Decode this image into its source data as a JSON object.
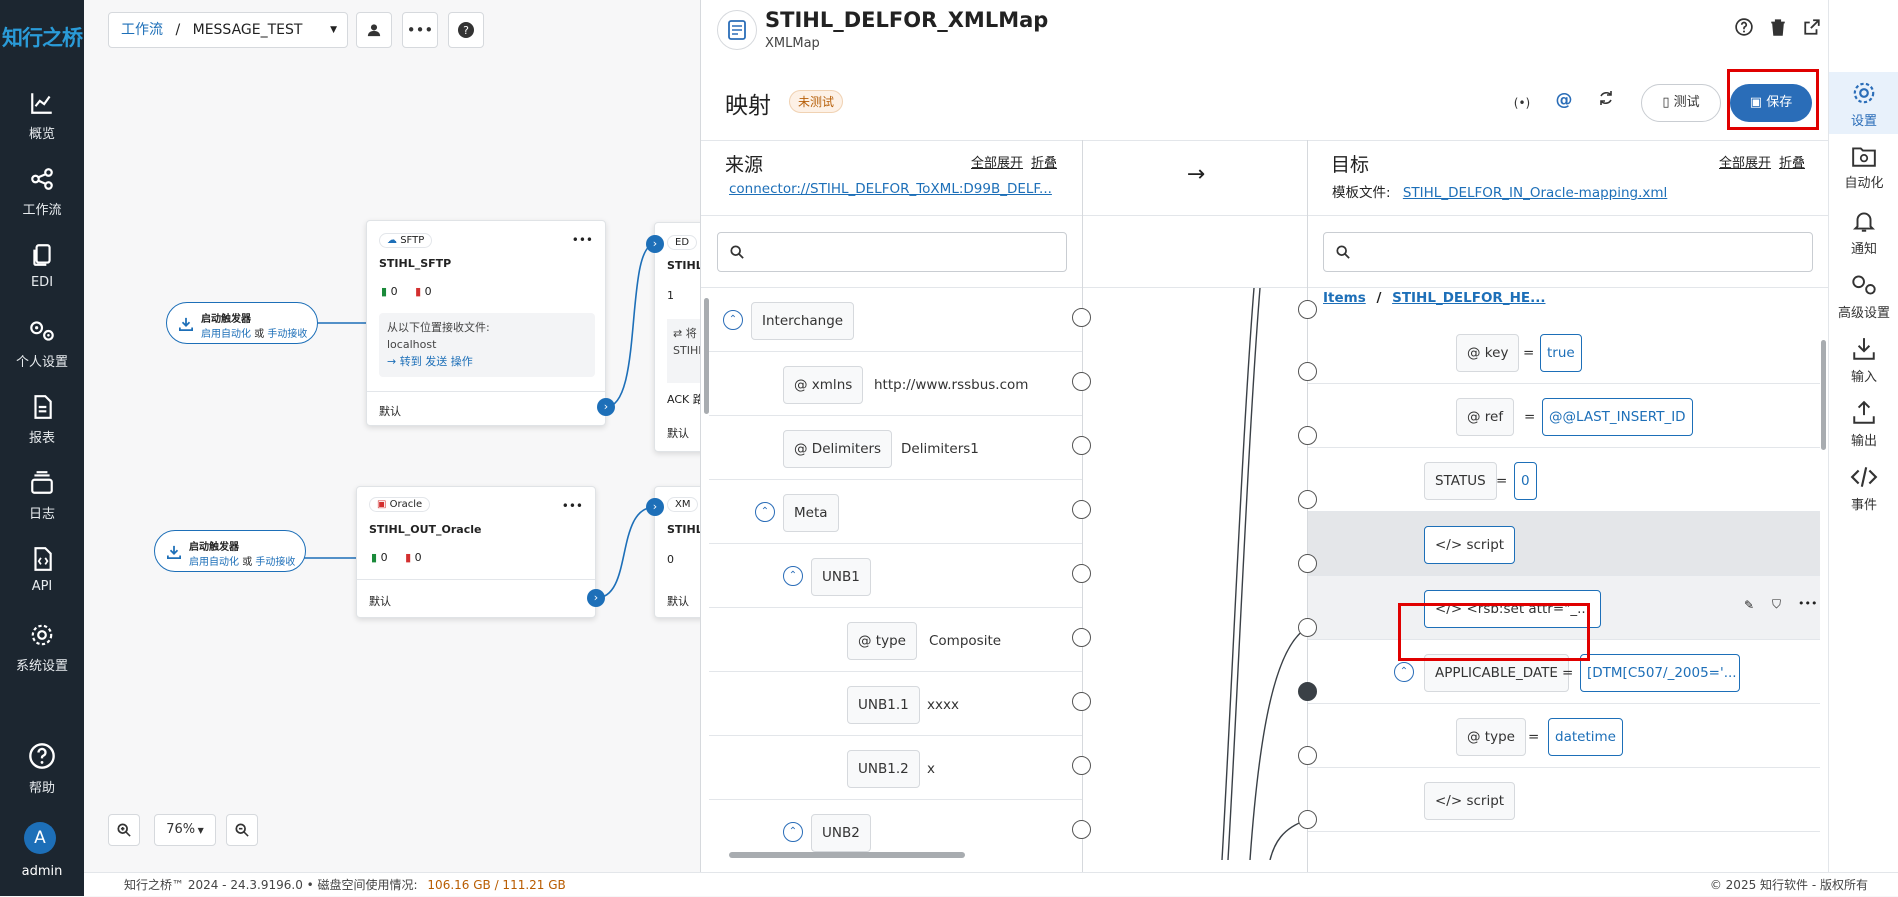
{
  "brand": {
    "logo": "知行之桥"
  },
  "leftnav": [
    {
      "label": "概览",
      "icon": "chart-line-icon"
    },
    {
      "label": "工作流",
      "icon": "workflow-icon"
    },
    {
      "label": "EDI",
      "icon": "documents-icon"
    },
    {
      "label": "个人设置",
      "icon": "user-settings-icon"
    },
    {
      "label": "报表",
      "icon": "report-icon"
    },
    {
      "label": "日志",
      "icon": "log-icon"
    },
    {
      "label": "API",
      "icon": "api-icon"
    },
    {
      "label": "系统设置",
      "icon": "gear-icon"
    },
    {
      "label": "帮助",
      "icon": "help-icon"
    }
  ],
  "user": {
    "initial": "A",
    "name": "admin"
  },
  "canvas": {
    "breadcrumb_link": "工作流",
    "breadcrumb_sep": "/",
    "workflow": "MESSAGE_TEST",
    "zoom": "76%",
    "nodes": [
      {
        "type": "SFTP",
        "name": "STIHL_SFTP",
        "ok": "0",
        "err": "0",
        "info": "从以下位置接收文件:",
        "host": "localhost",
        "links": "→ 转到 发送 操作",
        "footer": "默认"
      },
      {
        "type": "Oracle",
        "name": "STIHL_OUT_Oracle",
        "ok": "0",
        "err": "0",
        "footer": "默认"
      }
    ],
    "partial_nodes": [
      {
        "tag": "ED",
        "name": "STIHL_",
        "ok": "1",
        "line1": "⇄ 将",
        "line2": "STIHL",
        "line3": "ACK 路",
        "footer": "默认"
      },
      {
        "tag": "XM",
        "name": "STIHL_",
        "ok": "0",
        "footer": "默认"
      }
    ],
    "triggers": [
      {
        "title": "启动触发器",
        "link1": "启用自动化",
        "or": "或",
        "link2": "手动接收"
      },
      {
        "title": "启动触发器",
        "link1": "启用自动化",
        "or": "或",
        "link2": "手动接收"
      }
    ]
  },
  "panel": {
    "title": "STIHL_DELFOR_XMLMap",
    "subtitle": "XMLMap",
    "section": "映射",
    "badge": "未测试",
    "test_label": "测试",
    "save_label": "保存",
    "source": {
      "heading": "来源",
      "expand_all": "全部展开",
      "collapse": "折叠",
      "link": "connector://STIHL_DELFOR_ToXML:D99B_DELF...",
      "rows": [
        {
          "kind": "element",
          "name": "Interchange",
          "value": ""
        },
        {
          "kind": "attr",
          "name": "xmlns",
          "value": "http://www.rssbus.com"
        },
        {
          "kind": "attr",
          "name": "Delimiters",
          "value": "Delimiters1"
        },
        {
          "kind": "element",
          "name": "Meta",
          "value": ""
        },
        {
          "kind": "element",
          "name": "UNB1",
          "value": ""
        },
        {
          "kind": "attr",
          "name": "type",
          "value": "Composite"
        },
        {
          "kind": "leaf",
          "name": "UNB1.1",
          "value": "xxxx"
        },
        {
          "kind": "leaf",
          "name": "UNB1.2",
          "value": "x"
        },
        {
          "kind": "element",
          "name": "UNB2",
          "value": ""
        }
      ]
    },
    "arrow": "→",
    "target": {
      "heading": "目标",
      "expand_all": "全部展开",
      "collapse": "折叠",
      "template_label": "模板文件:",
      "template_link": "STIHL_DELFOR_IN_Oracle-mapping.xml",
      "breadcrumb_root": "Items",
      "breadcrumb_sep": "/",
      "breadcrumb_leaf": "STIHL_DELFOR_HE...",
      "rows": [
        {
          "kind": "attr",
          "name": "key",
          "eq": "=",
          "value": "true"
        },
        {
          "kind": "attr",
          "name": "ref",
          "eq": "=",
          "value": "@@LAST_INSERT_ID"
        },
        {
          "kind": "leaf",
          "name": "STATUS",
          "eq": "=",
          "value": "0"
        },
        {
          "kind": "script",
          "name": "script",
          "eq": "",
          "value": ""
        },
        {
          "kind": "script",
          "name": "<rsb:set attr=\"_...",
          "eq": "",
          "value": ""
        },
        {
          "kind": "element",
          "name": "APPLICABLE_DATE",
          "eq": "=",
          "value": "[DTM[C507/_2005='..."
        },
        {
          "kind": "attr",
          "name": "type",
          "eq": "=",
          "value": "datetime"
        },
        {
          "kind": "script",
          "name": "script",
          "eq": "",
          "value": ""
        }
      ]
    }
  },
  "rightnav": [
    {
      "label": "设置",
      "icon": "gear-icon"
    },
    {
      "label": "自动化",
      "icon": "automation-folder-icon"
    },
    {
      "label": "通知",
      "icon": "bell-icon"
    },
    {
      "label": "高级设置",
      "icon": "advanced-gear-icon"
    },
    {
      "label": "输入",
      "icon": "input-icon"
    },
    {
      "label": "输出",
      "icon": "output-icon"
    },
    {
      "label": "事件",
      "icon": "code-icon"
    }
  ],
  "footer": {
    "left": "知行之桥™ 2024 - 24.3.9196.0  •  磁盘空间使用情况:",
    "disk": "106.16 GB / 111.21 GB",
    "right": "© 2025 知行软件 - 版权所有"
  }
}
